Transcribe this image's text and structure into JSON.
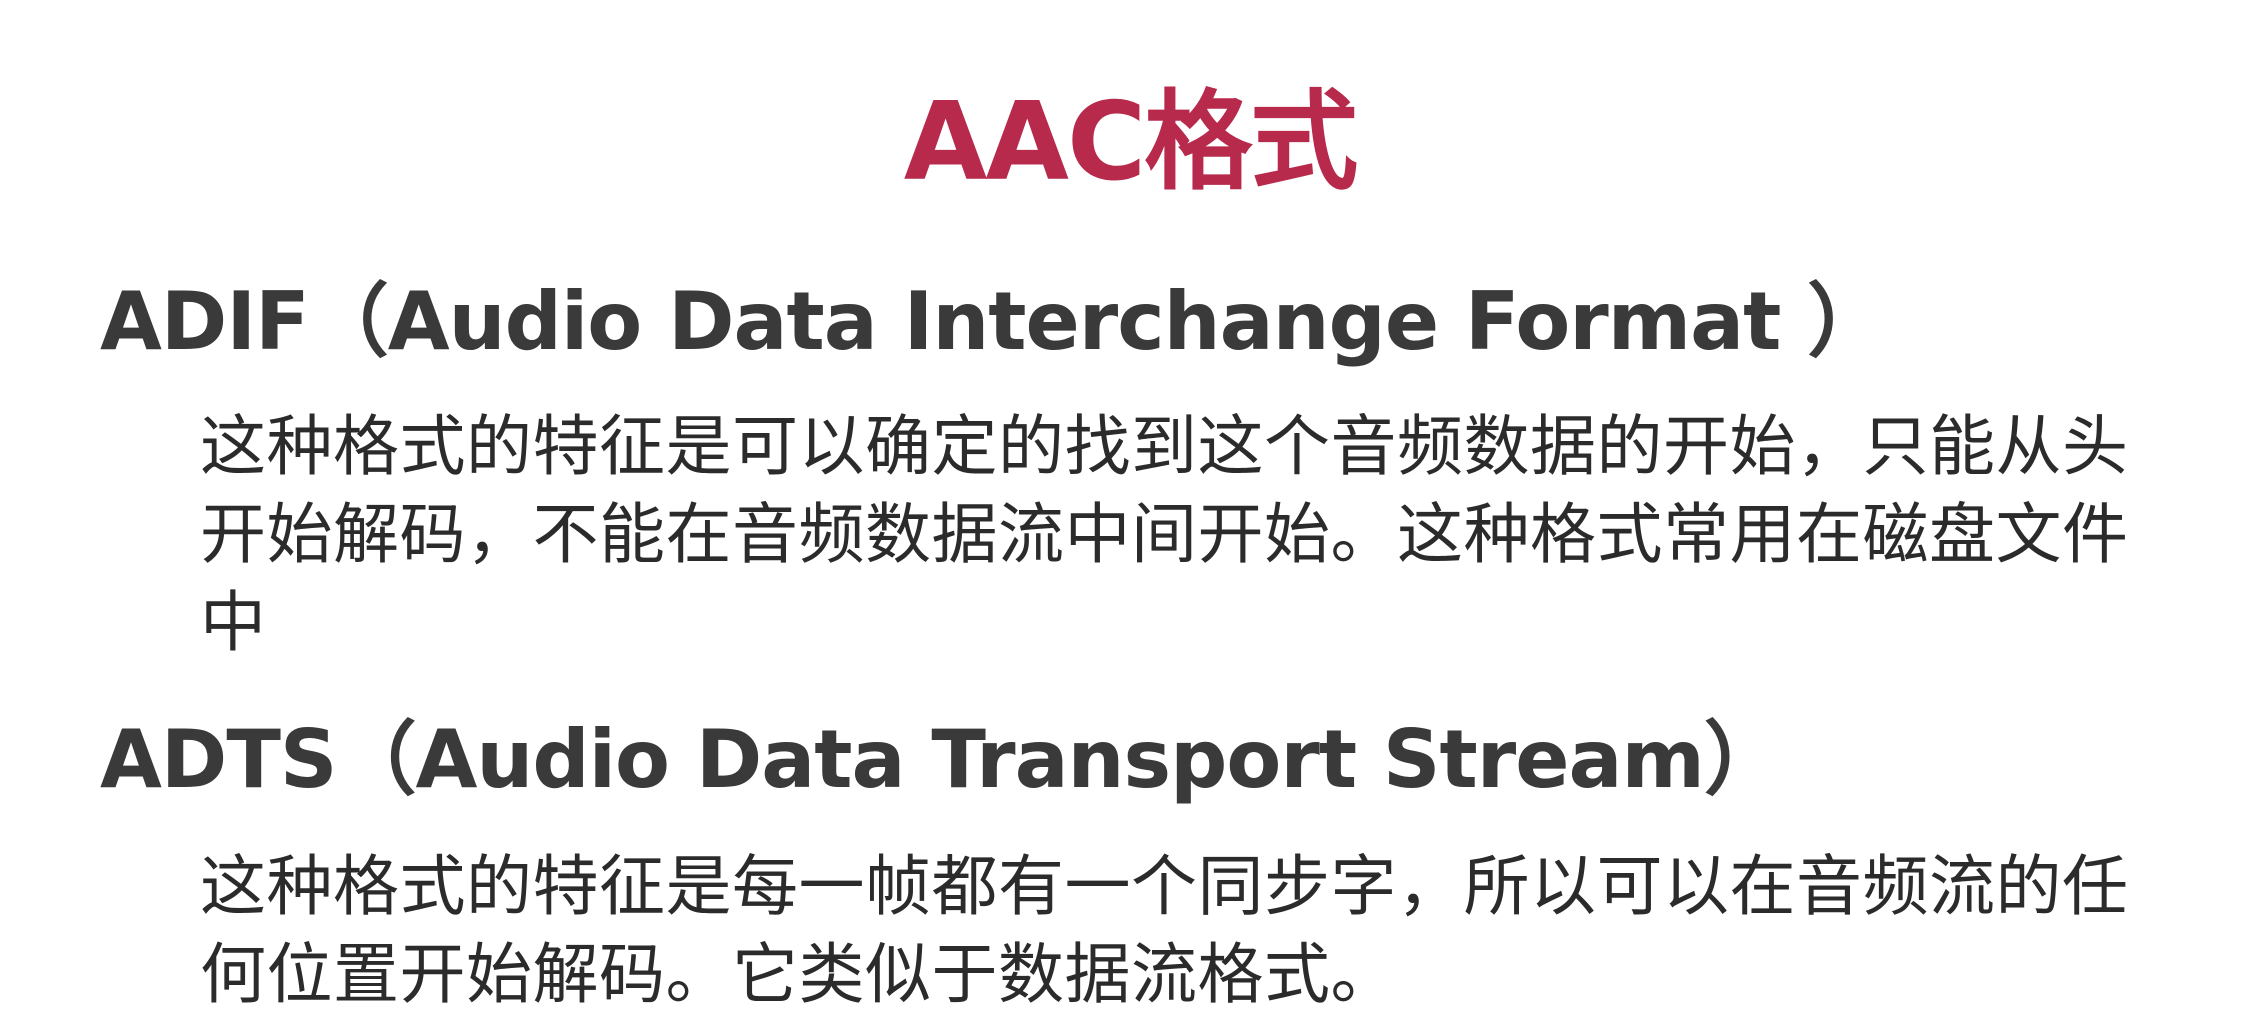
{
  "slide": {
    "title": "AAC格式",
    "sections": [
      {
        "heading": "ADIF（Audio Data Interchange Format  ）",
        "body": "这种格式的特征是可以确定的找到这个音频数据的开始，只能从头开始解码，不能在音频数据流中间开始。这种格式常用在磁盘文件中"
      },
      {
        "heading": "ADTS（Audio Data Transport Stream）",
        "body": "这种格式的特征是每一帧都有一个同步字，所以可以在音频流的任何位置开始解码。它类似于数据流格式。"
      }
    ],
    "colors": {
      "title": "#b82a4c",
      "heading": "#3a3a3a",
      "body": "#2b2b2b",
      "background": "#ffffff"
    }
  }
}
